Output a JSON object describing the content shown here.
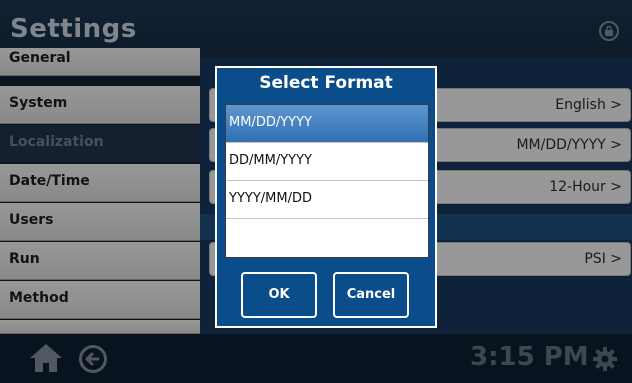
{
  "header": {
    "title": "Settings",
    "lock_icon": "lock-icon"
  },
  "sidebar": {
    "items": [
      {
        "label": "General"
      },
      {
        "label": "System"
      },
      {
        "label": "Localization",
        "active": true
      },
      {
        "label": "Date/Time"
      },
      {
        "label": "Users"
      },
      {
        "label": "Run"
      },
      {
        "label": "Method"
      }
    ]
  },
  "content": {
    "rows": [
      {
        "value": "English >"
      },
      {
        "value": "MM/DD/YYYY >"
      },
      {
        "value": "12-Hour >"
      },
      {
        "value": "PSI >"
      }
    ]
  },
  "dialog": {
    "title": "Select Format",
    "options": [
      "MM/DD/YYYY",
      "DD/MM/YYYY",
      "YYYY/MM/DD"
    ],
    "selected": "MM/DD/YYYY",
    "ok_label": "OK",
    "cancel_label": "Cancel"
  },
  "footer": {
    "time": "3:15 PM",
    "icons": [
      "home-icon",
      "back-icon",
      "gear-icon"
    ]
  },
  "colors": {
    "header": "#1b3550",
    "dialog": "#0b4d8a",
    "selection": "#2f6fb1"
  }
}
